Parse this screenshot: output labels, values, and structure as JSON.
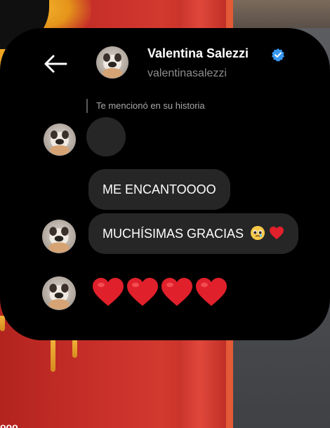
{
  "header": {
    "display_name": "Valentina Salezzi",
    "username": "valentinasalezzi",
    "back_icon": "arrow-left-icon",
    "verified_icon": "verified-badge-icon"
  },
  "messages": {
    "story_mention_note": "Te mencionó en su historia",
    "message_1": "ME ENCANTOOOO",
    "message_2": "MUCHÍSIMAS GRACIAS",
    "message_2_emojis": [
      "pleading-face-icon",
      "red-heart-icon"
    ],
    "message_3_emojis": [
      "red-heart-icon",
      "red-heart-icon",
      "red-heart-icon",
      "red-heart-icon"
    ]
  },
  "colors": {
    "card_bg": "#000000",
    "bubble_bg": "#262626",
    "verified_blue": "#3897f0",
    "heart_red": "#e0202b"
  },
  "background": {
    "bottom_partial_text": "ооо"
  }
}
